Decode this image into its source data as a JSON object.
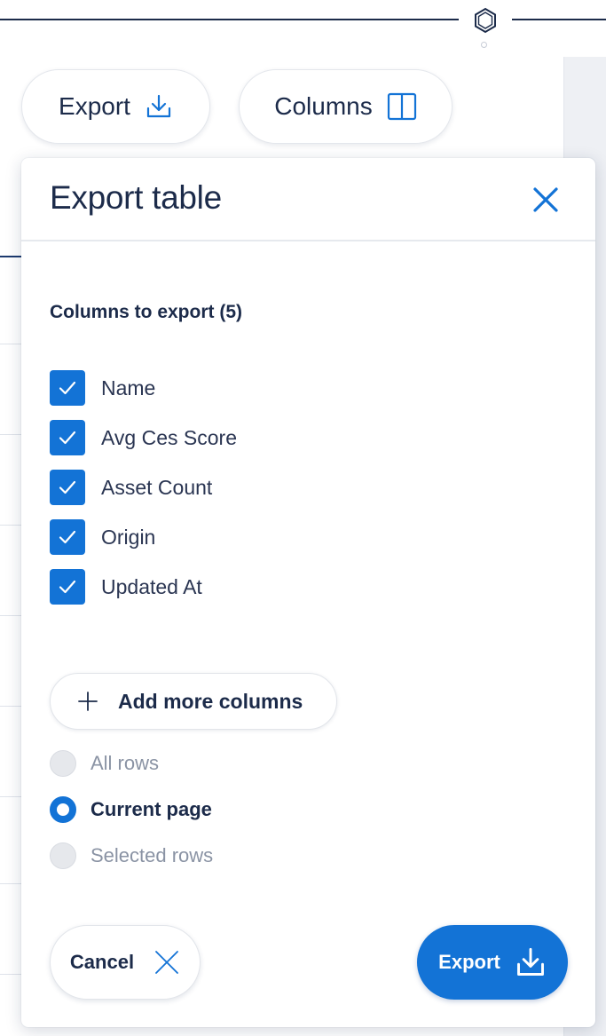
{
  "toolbar": {
    "export_label": "Export",
    "columns_label": "Columns"
  },
  "modal": {
    "title": "Export table",
    "section_label": "Columns to export (5)",
    "columns": [
      {
        "label": "Name",
        "checked": true
      },
      {
        "label": "Avg Ces Score",
        "checked": true
      },
      {
        "label": "Asset Count",
        "checked": true
      },
      {
        "label": "Origin",
        "checked": true
      },
      {
        "label": "Updated At",
        "checked": true
      }
    ],
    "add_columns_label": "Add more columns",
    "row_options": [
      {
        "label": "All rows",
        "selected": false
      },
      {
        "label": "Current page",
        "selected": true
      },
      {
        "label": "Selected rows",
        "selected": false
      }
    ],
    "cancel_label": "Cancel",
    "export_label": "Export"
  },
  "icons": {
    "logo": "hexagon-logo-icon",
    "export": "download-icon",
    "columns": "columns-icon",
    "close": "close-icon",
    "check": "check-icon",
    "add": "plus-icon",
    "cancel": "close-icon"
  },
  "colors": {
    "accent": "#1373d6",
    "text": "#1c2b4a",
    "muted": "#8a93a4"
  }
}
